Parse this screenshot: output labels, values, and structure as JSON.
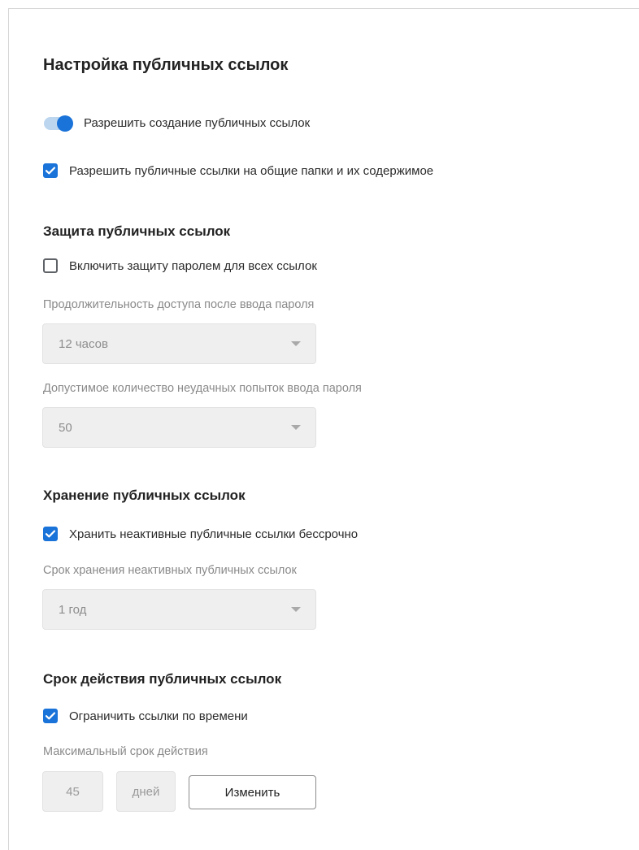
{
  "page_title": "Настройка публичных ссылок",
  "toggle_allow": {
    "label": "Разрешить создание публичных ссылок",
    "on": true
  },
  "check_shared_folders": {
    "label": "Разрешить публичные ссылки на общие папки и их содержимое",
    "checked": true
  },
  "protection": {
    "title": "Защита публичных ссылок",
    "password_check": {
      "label": "Включить защиту паролем для всех ссылок",
      "checked": false
    },
    "duration_label": "Продолжительность доступа после ввода пароля",
    "duration_value": "12 часов",
    "attempts_label": "Допустимое количество неудачных попыток ввода пароля",
    "attempts_value": "50"
  },
  "storage": {
    "title": "Хранение публичных ссылок",
    "forever_check": {
      "label": "Хранить неактивные публичные ссылки бессрочно",
      "checked": true
    },
    "period_label": "Срок хранения неактивных публичных ссылок",
    "period_value": "1 год"
  },
  "expiry": {
    "title": "Срок действия публичных ссылок",
    "limit_check": {
      "label": "Ограничить ссылки по времени",
      "checked": true
    },
    "max_label": "Максимальный срок действия",
    "max_value": "45",
    "max_unit": "дней",
    "change_button": "Изменить"
  },
  "colors": {
    "accent": "#1a73d9",
    "disabled_fill": "#efefef",
    "muted_text": "#8a8a8a"
  },
  "icons": {
    "checkmark": "check-icon",
    "dropdown": "chevron-down-icon"
  }
}
